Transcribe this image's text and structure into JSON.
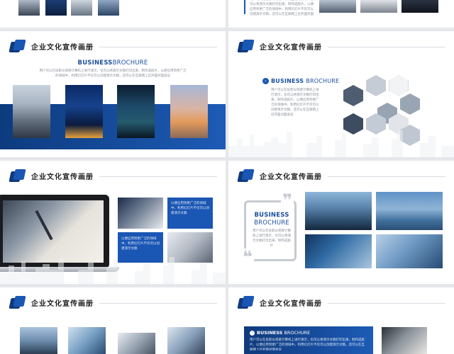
{
  "header": {
    "title": "企业文化宣传画册"
  },
  "brochure": {
    "bold": "BUSINESS",
    "light": "BROCHURE",
    "stack1": "BUSINESS",
    "stack2": "BROCHURE"
  },
  "body_text": {
    "para_a": "用户可以在投影仪或者计算机上进行演示，也可以将演示文稿打印出来，制作成胶片，以便应用到更广泛的领域中。利用幻灯片不仅可以创建演示文稿，还可以在互联网上召开面对面会议",
    "para_b": "以便应用到更广泛的领域中，利用幻灯片不仅可以创建演示文稿",
    "para_c": "用户可以在投影仪或者计算机上进行演示，也可以将演示文稿打印出来，制作成胶片",
    "para_d": "以便应用到更广泛的领域中，利用幻灯片不仅可以创建演示文稿"
  },
  "colors": {
    "accent": "#1a56b4",
    "dark": "#0f3a7c"
  }
}
